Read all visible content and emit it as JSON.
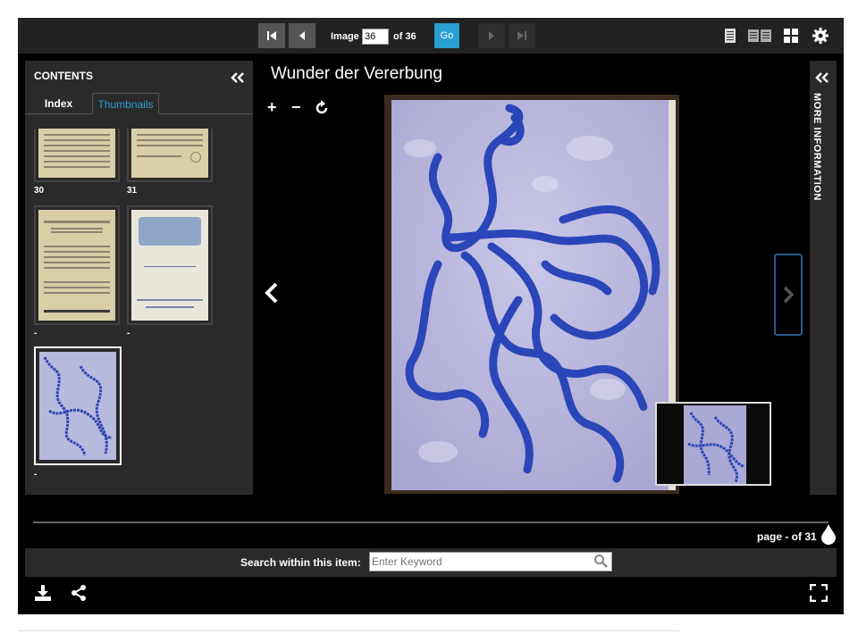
{
  "toolbar": {
    "first_icon": "first-page-icon",
    "prev_icon": "previous-page-icon",
    "image_label": "Image",
    "image_value": "36",
    "of_label": "of 36",
    "go_label": "Go",
    "next_icon": "next-page-icon",
    "last_icon": "last-page-icon",
    "view_icons": [
      "single-page-view-icon",
      "two-page-view-icon",
      "grid-view-icon",
      "settings-gear-icon"
    ]
  },
  "contents": {
    "title": "CONTENTS",
    "collapse_icon": "double-chevron-left-icon",
    "tabs": [
      {
        "label": "Index",
        "active": false
      },
      {
        "label": "Thumbnails",
        "active": true
      }
    ],
    "thumbnails": [
      {
        "label": "30"
      },
      {
        "label": "31"
      },
      {
        "label": "-"
      },
      {
        "label": "-"
      },
      {
        "label": "-",
        "selected": true
      }
    ]
  },
  "main": {
    "title": "Wunder der Vererbung",
    "zoom_in": "+",
    "zoom_out": "−",
    "rotate_icon": "rotate-icon",
    "prev_icon": "chevron-left-icon",
    "next_icon": "chevron-right-icon"
  },
  "info_panel": {
    "label": "MORE INFORMATION",
    "expand_icon": "double-chevron-left-icon"
  },
  "footer": {
    "page_count": "page - of 31",
    "search_label": "Search within this item:",
    "search_placeholder": "Enter Keyword",
    "download_icon": "download-icon",
    "share_icon": "share-icon",
    "fullscreen_icon": "fullscreen-icon"
  },
  "colors": {
    "accent": "#2aa0d2",
    "panel": "#2a2a2a",
    "toolbar": "#222222",
    "background": "#000000"
  }
}
